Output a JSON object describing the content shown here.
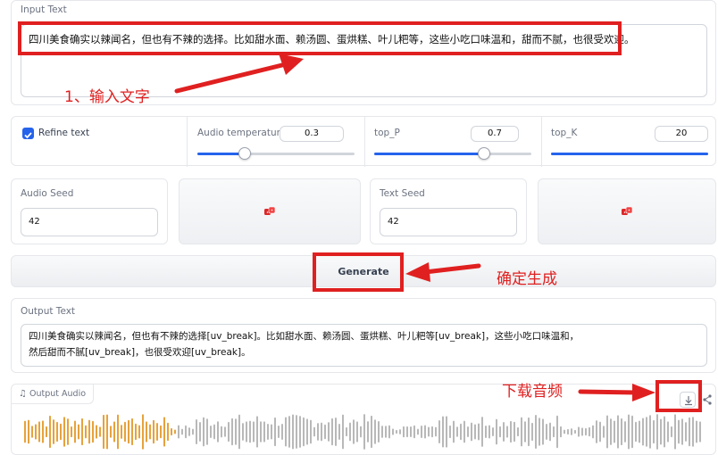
{
  "input": {
    "label": "Input Text",
    "value": "四川美食确实以辣闻名，但也有不辣的选择。比如甜水面、赖汤圆、蛋烘糕、叶儿粑等，这些小吃口味温和，甜而不腻，也很受欢迎。"
  },
  "controls": {
    "refine_label": "Refine text",
    "refine_checked": true,
    "audio_temperature": {
      "label": "Audio temperature",
      "value": "0.3",
      "fraction": 0.3
    },
    "top_p": {
      "label": "top_P",
      "value": "0.7",
      "fraction": 0.7
    },
    "top_k": {
      "label": "top_K",
      "value": "20",
      "fraction": 1.0
    }
  },
  "audio_seed": {
    "label": "Audio Seed",
    "value": "42"
  },
  "text_seed": {
    "label": "Text Seed",
    "value": "42"
  },
  "dice_icon": "dice-icon",
  "generate_label": "Generate",
  "output": {
    "label": "Output Text",
    "line1": "四川美食确实以辣闻名，但也有不辣的选择[uv_break]。比如甜水面、赖汤圆、蛋烘糕、叶儿粑等[uv_break]，这些小吃口味温和，",
    "line2": "然后甜而不腻[uv_break]，也很受欢迎[uv_break]。"
  },
  "output_audio": {
    "label": "Output Audio",
    "icon": "music-note-icon"
  },
  "annotations": {
    "step1": "1、输入文字",
    "step2": "确定生成",
    "step3": "下载音频"
  },
  "colors": {
    "annotation_red": "#e02020",
    "slider_blue": "#2563eb",
    "wave_played": "#e6a23c",
    "wave_unplayed": "#b8b8b8"
  }
}
